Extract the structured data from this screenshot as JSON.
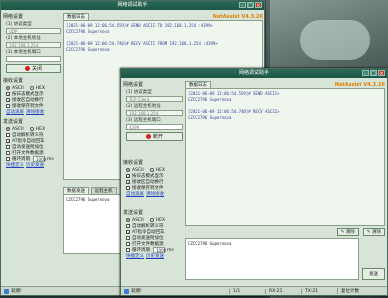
{
  "back": {
    "title": "网络调试助手",
    "brand": "NetAssist V4.3.26",
    "network_settings": "网络设置",
    "protocol_label": "(1) 协议类型",
    "protocol_value": "UDP",
    "host_label": "(2) 本地主机地址",
    "host_value": "192.168.1.254",
    "port_label": "(3) 本地主机端口",
    "close_button": "关闭",
    "recv_settings": "接收设置",
    "ascii": "ASCII",
    "hex": "HEX",
    "opt_logmode": "按日志模式显示",
    "opt_autowrap": "接收区自动换行",
    "opt_hide": "接收保存到文件",
    "link_autoscroll": "自动滚屏",
    "link_clear": "清除接收",
    "send_settings": "发送设置",
    "opt_parse_escape": "自动解析转义符",
    "opt_at_enter": "AT指令自动回车",
    "opt_auto_checksum": "自动发送附加位",
    "opt_open_file": "打开文件数据源",
    "opt_loop": "循环周期",
    "loop_value": "1000",
    "loop_unit": "ms",
    "link_quick": "快捷定义",
    "link_history": "历史发送",
    "tab_data_log": "数据日志",
    "log": [
      "[2021-06-09 12:06:54.559]# SEND ASCII TO 192.168.1.254 :4399>",
      "CZCC2796   Supernova",
      "",
      "[2021-06-09 12:06:54.740]# RECV ASCII FROM 192.168.1.254 :4399>",
      "CZCC2796   Supernova"
    ],
    "tab_send": "数据发送",
    "tab_remote": "远程主机",
    "send_text": "CZCC2796   Supernova",
    "status_ready": "就绪!"
  },
  "front": {
    "title": "网络调试助手",
    "brand": "NetAssist V4.3.26",
    "network_settings": "网络设置",
    "protocol_label": "(1) 协议类型",
    "protocol_value": "TCP Client",
    "host_label": "(2) 远程主机地址",
    "host_value": "192.168.1.254",
    "port_label": "(3) 远程主机端口",
    "port_value": "4399",
    "disconnect_button": "断开",
    "recv_settings": "接收设置",
    "ascii": "ASCII",
    "hex": "HEX",
    "opt_logmode": "按日志模式显示",
    "opt_autowrap": "接收区自动换行",
    "opt_hide": "接收保存到文件",
    "link_autoscroll": "自动滚屏",
    "link_clear": "清除接收",
    "send_settings": "发送设置",
    "opt_parse_escape": "自动解析转义符",
    "opt_at_enter": "AT指令自动回车",
    "opt_auto_checksum": "自动发送附加位",
    "opt_open_file": "打开文件数据源",
    "opt_loop": "循环周期",
    "loop_value": "1000",
    "loop_unit": "ms",
    "link_quick": "快捷定义",
    "link_history": "历史发送",
    "tab_data_log": "数据日志",
    "log": [
      "[2021-06-09 12:06:54.559]# SEND ASCII>",
      "CZCC2796   Supernova",
      "",
      "[2021-06-09 12:06:54.740]# RECV ASCII>",
      "CZCC2796   Supernova"
    ],
    "send_text": "CZCC2796   Supernova",
    "clear_button": "清除",
    "clear_button2": "清除",
    "send_button": "发送",
    "status_ready": "就绪!",
    "status_page": "1/1",
    "status_rx": "RX:21",
    "status_tx": "TX:21",
    "status_reset": "复位计数"
  }
}
